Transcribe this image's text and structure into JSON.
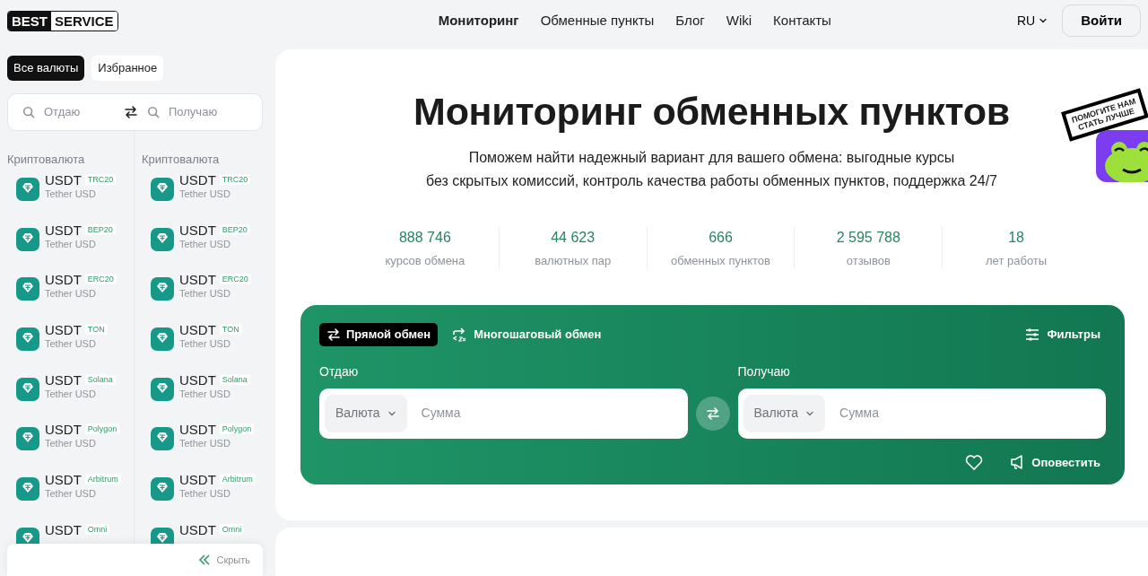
{
  "header": {
    "logo": {
      "dark_part": "BEST",
      "light_part": "SERVICE"
    },
    "nav": [
      {
        "label": "Мониторинг",
        "selected": true
      },
      {
        "label": "Обменные пункты",
        "selected": false
      },
      {
        "label": "Блог",
        "selected": false
      },
      {
        "label": "Wiki",
        "selected": false
      },
      {
        "label": "Контакты",
        "selected": false
      }
    ],
    "language": "RU",
    "login": "Войти"
  },
  "sidebar": {
    "tabs": [
      {
        "label": "Все валюты",
        "selected": true
      },
      {
        "label": "Избранное",
        "selected": false
      }
    ],
    "search": {
      "give_placeholder": "Отдаю",
      "get_placeholder": "Получаю"
    },
    "columns": [
      {
        "heading": "Криптовалюта",
        "items": [
          {
            "ticker": "USDT",
            "network": "TRC20",
            "name": "Tether USD"
          },
          {
            "ticker": "USDT",
            "network": "BEP20",
            "name": "Tether USD"
          },
          {
            "ticker": "USDT",
            "network": "ERC20",
            "name": "Tether USD"
          },
          {
            "ticker": "USDT",
            "network": "TON",
            "name": "Tether USD"
          },
          {
            "ticker": "USDT",
            "network": "Solana",
            "name": "Tether USD"
          },
          {
            "ticker": "USDT",
            "network": "Polygon",
            "name": "Tether USD"
          },
          {
            "ticker": "USDT",
            "network": "Arbitrum",
            "name": "Tether USD"
          },
          {
            "ticker": "USDT",
            "network": "Omni"
          }
        ]
      },
      {
        "heading": "Криптовалюта",
        "items": [
          {
            "ticker": "USDT",
            "network": "TRC20",
            "name": "Tether USD"
          },
          {
            "ticker": "USDT",
            "network": "BEP20",
            "name": "Tether USD"
          },
          {
            "ticker": "USDT",
            "network": "ERC20",
            "name": "Tether USD"
          },
          {
            "ticker": "USDT",
            "network": "TON",
            "name": "Tether USD"
          },
          {
            "ticker": "USDT",
            "network": "Solana",
            "name": "Tether USD"
          },
          {
            "ticker": "USDT",
            "network": "Polygon",
            "name": "Tether USD"
          },
          {
            "ticker": "USDT",
            "network": "Arbitrum",
            "name": "Tether USD"
          },
          {
            "ticker": "USDT",
            "network": "Omni"
          }
        ]
      }
    ],
    "hide_button": "Скрыть"
  },
  "hero": {
    "title": "Мониторинг обменных пунктов",
    "subtitle_lines": [
      "Поможем найти надежный вариант для вашего обмена: выгодные курсы",
      "без скрытых комиссий, контроль качества работы обменных пунктов, поддержка 24/7"
    ],
    "sticker_lines": [
      "ПОМОГИТЕ НАМ",
      "СТАТЬ ЛУЧШЕ"
    ],
    "stats": [
      {
        "value": "888 746",
        "label": "курсов обмена"
      },
      {
        "value": "44 623",
        "label": "валютных пар"
      },
      {
        "value": "666",
        "label": "обменных пунктов"
      },
      {
        "value": "2 595 788",
        "label": "отзывов"
      },
      {
        "value": "18",
        "label": "лет работы"
      }
    ]
  },
  "exchange": {
    "modes": [
      {
        "kind": "direct",
        "label": "Прямой обмен",
        "selected": true
      },
      {
        "kind": "multistep",
        "label": "Многошаговый обмен",
        "selected": false
      }
    ],
    "filters": "Фильтры",
    "sides": [
      {
        "label": "Отдаю",
        "currency": "Валюта",
        "amount_placeholder": "Сумма"
      },
      {
        "label": "Получаю",
        "currency": "Валюта",
        "amount_placeholder": "Сумма"
      }
    ],
    "notify": "Оповестить"
  }
}
